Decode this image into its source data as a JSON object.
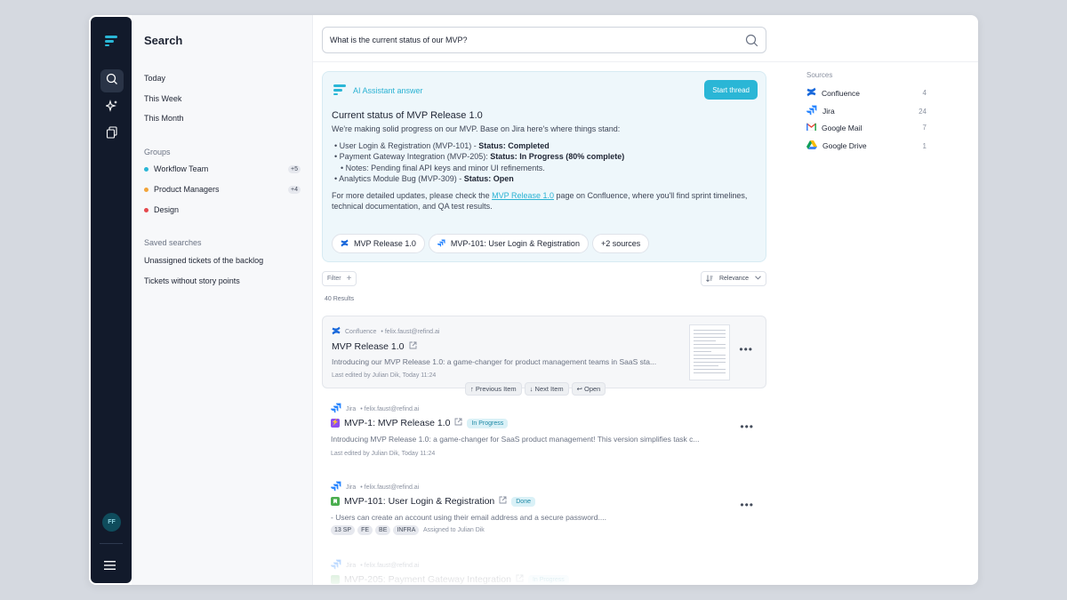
{
  "colors": {
    "accent": "#2ab6d6",
    "rail": "#121a2b",
    "jira": "#2684ff",
    "confluence": "#1868db"
  },
  "rail": {
    "user_initials": "FF",
    "icons": [
      "search-icon",
      "sparkle-icon",
      "copy-icon",
      "menu-icon"
    ]
  },
  "left_panel": {
    "title": "Search",
    "time_filters": [
      "Today",
      "This Week",
      "This Month"
    ],
    "groups_label": "Groups",
    "groups": [
      {
        "name": "Workflow Team",
        "count": "+5",
        "color": "#2ab6d6"
      },
      {
        "name": "Product Managers",
        "count": "+4",
        "color": "#f2a43a"
      },
      {
        "name": "Design",
        "count": "",
        "color": "#e5484d"
      }
    ],
    "saved_label": "Saved searches",
    "saved": [
      "Unassigned tickets of the backlog",
      "Tickets without story points"
    ]
  },
  "search": {
    "query": "What is the current status of our MVP?"
  },
  "ai": {
    "label": "AI Assistant answer",
    "start_thread": "Start thread",
    "title": "Current status of MVP Release 1.0",
    "intro": "We're making solid progress on our MVP. Base on Jira here's where things stand:",
    "items": [
      {
        "text": "User Login & Registration (MVP-101) - ",
        "status": "Status: Completed"
      },
      {
        "text": "Payment Gateway Integration (MVP-205): ",
        "status": "Status: In Progress (80% complete)"
      },
      {
        "text": "Notes: Pending final API keys and minor UI refinements.",
        "status": ""
      },
      {
        "text": "Analytics Module Bug (MVP-309) - ",
        "status": "Status: Open"
      }
    ],
    "outro_before": "For more detailed updates, please check the ",
    "outro_link": "MVP Release 1.0",
    "outro_after": " page on Confluence, where you'll find sprint timelines,",
    "outro_line2": "technical documentation, and QA test results.",
    "chips": [
      "MVP Release 1.0",
      "MVP-101: User Login & Registration",
      "+2 sources"
    ]
  },
  "toolbar": {
    "filter": "Filter",
    "sort": "Relevance",
    "results_count": "40 Results"
  },
  "results": [
    {
      "source": "Confluence",
      "meta": "• felix.faust@refind.ai",
      "title": "MVP Release 1.0",
      "status": "",
      "desc": "Introducing our MVP Release 1.0: a game-changer for product management teams in SaaS sta...",
      "foot": "Last edited by Julian Dik, Today 11:24"
    },
    {
      "source": "Jira",
      "meta": "• felix.faust@refind.ai",
      "title": "MVP-1: MVP Release 1.0",
      "status": "In Progress",
      "desc": "Introducing MVP Release 1.0: a game-changer for SaaS product management! This version simplifies task c...",
      "foot": "Last edited by Julian Dik, Today 11:24"
    },
    {
      "source": "Jira",
      "meta": "• felix.faust@refind.ai",
      "title": "MVP-101: User Login & Registration",
      "status": "Done",
      "desc": "- Users can create an account using their email address and a secure password....",
      "tags": [
        "13 SP",
        "FE",
        "BE",
        "INFRA"
      ],
      "foot": "Assigned to Julian Dik"
    },
    {
      "source": "Jira",
      "meta": "• felix.faust@refind.ai",
      "title": "MVP-205: Payment Gateway Integration",
      "status": "In Progress"
    }
  ],
  "kbd": {
    "prev": "↑ Previous Item",
    "next": "↓ Next Item",
    "open": "↩ Open"
  },
  "sources": {
    "label": "Sources",
    "items": [
      {
        "name": "Confluence",
        "count": "4"
      },
      {
        "name": "Jira",
        "count": "24"
      },
      {
        "name": "Google Mail",
        "count": "7"
      },
      {
        "name": "Google Drive",
        "count": "1"
      }
    ]
  }
}
